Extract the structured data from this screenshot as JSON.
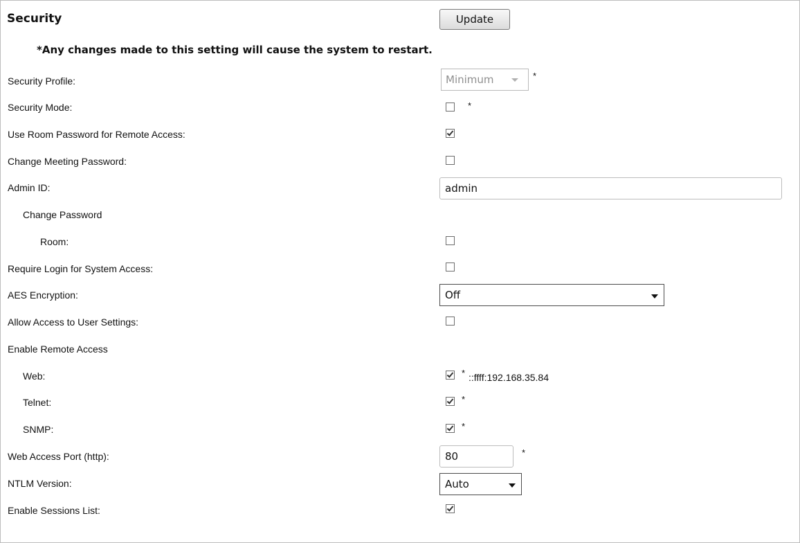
{
  "header": {
    "title": "Security",
    "update_label": "Update"
  },
  "notice": "*Any changes made to this setting will cause the system to restart.",
  "required_marker": "*",
  "fields": {
    "security_profile": {
      "label": "Security Profile:",
      "value": "Minimum",
      "disabled": true
    },
    "security_mode": {
      "label": "Security Mode:",
      "checked": false
    },
    "room_password_remote": {
      "label": "Use Room Password for Remote Access:",
      "checked": true
    },
    "change_meeting_password": {
      "label": "Change Meeting Password:",
      "checked": false
    },
    "admin_id": {
      "label": "Admin ID:",
      "value": "admin"
    },
    "change_password": {
      "label": "Change Password"
    },
    "room": {
      "label": "Room:",
      "checked": false
    },
    "require_login": {
      "label": "Require Login for System Access:",
      "checked": false
    },
    "aes_encryption": {
      "label": "AES Encryption:",
      "value": "Off"
    },
    "allow_user_settings": {
      "label": "Allow Access to User Settings:",
      "checked": false
    },
    "enable_remote_access": {
      "label": "Enable Remote Access"
    },
    "web": {
      "label": "Web:",
      "checked": true,
      "address": "::ffff:192.168.35.84"
    },
    "telnet": {
      "label": "Telnet:",
      "checked": true
    },
    "snmp": {
      "label": "SNMP:",
      "checked": true
    },
    "web_access_port": {
      "label": "Web Access Port (http):",
      "value": "80"
    },
    "ntlm_version": {
      "label": "NTLM Version:",
      "value": "Auto"
    },
    "enable_sessions_list": {
      "label": "Enable Sessions List:",
      "checked": true
    }
  },
  "icons": {
    "dropdown": "chevron-down-icon",
    "checkbox": "checkbox-icon"
  }
}
